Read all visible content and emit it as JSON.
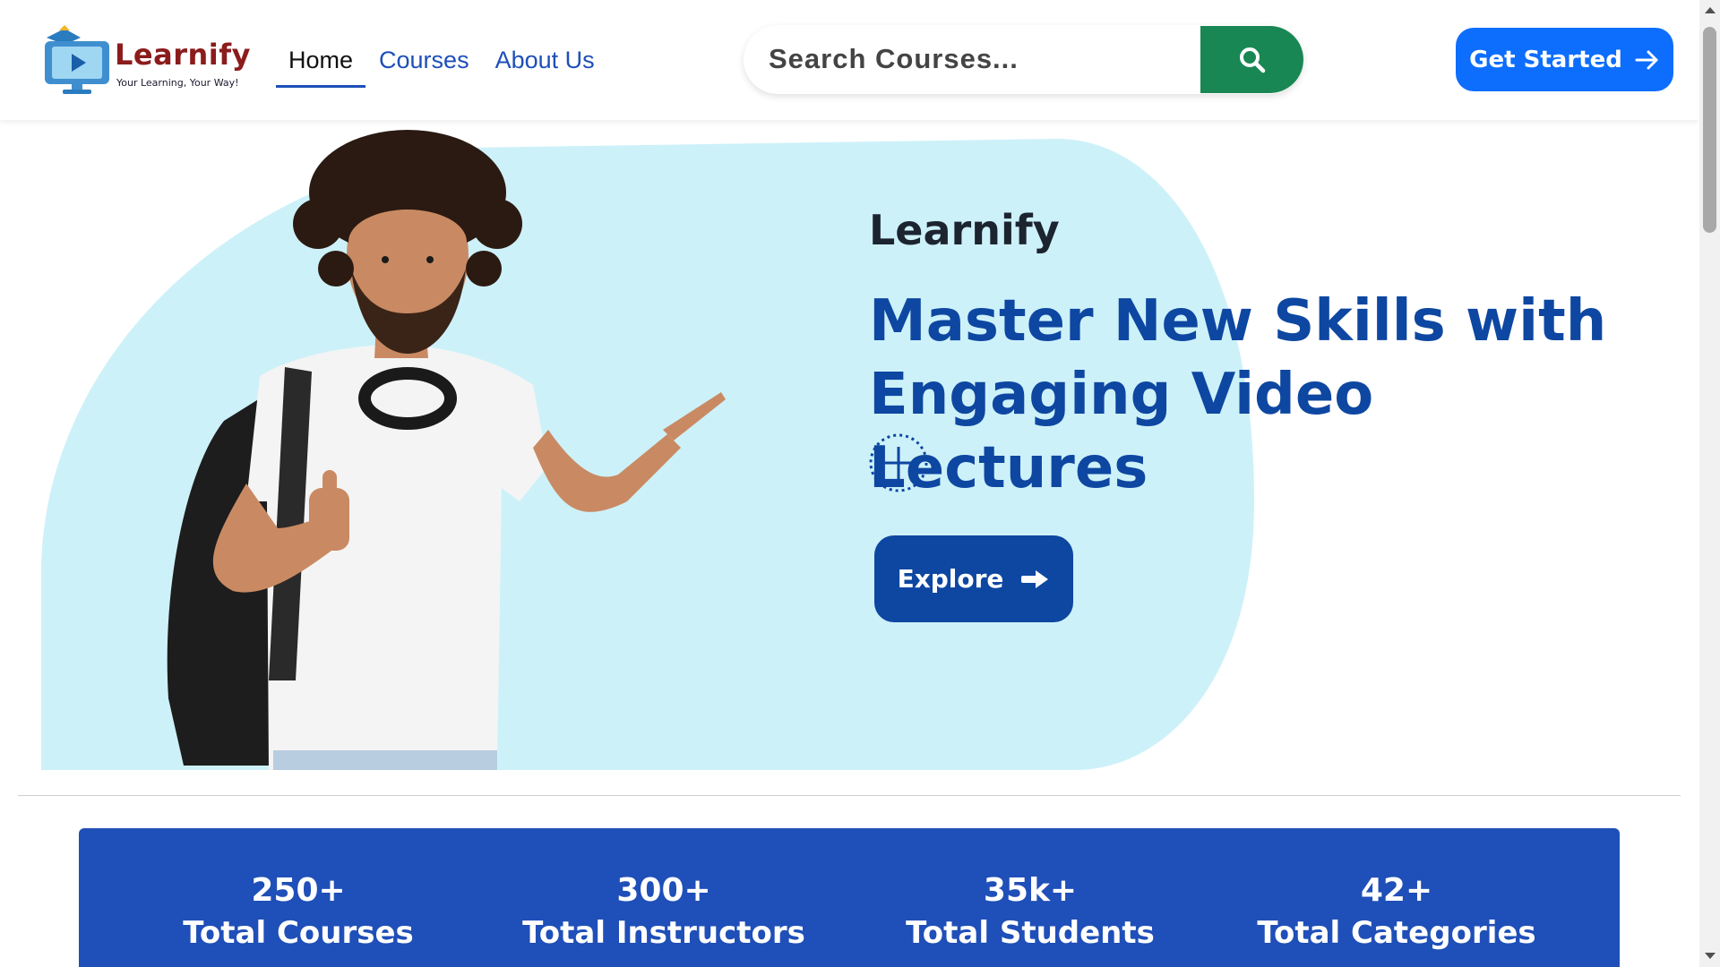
{
  "brand": {
    "name": "Learnify",
    "tagline": "Your Learning, Your Way!"
  },
  "nav": {
    "items": [
      {
        "label": "Home",
        "active": true
      },
      {
        "label": "Courses",
        "active": false
      },
      {
        "label": "About Us",
        "active": false
      }
    ]
  },
  "search": {
    "placeholder": "Search Courses...",
    "value": "",
    "button_icon": "search-icon"
  },
  "header_cta": {
    "label": "Get Started",
    "icon": "arrow-right-icon"
  },
  "hero": {
    "eyebrow": "Learnify",
    "title": "Master New Skills with Engaging Video Lectures",
    "explore_label": "Explore",
    "explore_icon": "arrow-right-icon",
    "decor_icon": "plus-circle-icon"
  },
  "stats": [
    {
      "value": "250+",
      "label": "Total Courses"
    },
    {
      "value": "300+",
      "label": "Total Instructors"
    },
    {
      "value": "35k+",
      "label": "Total Students"
    },
    {
      "value": "42+",
      "label": "Total Categories"
    }
  ],
  "colors": {
    "primary": "#0d6efd",
    "dark_blue": "#0d47a1",
    "stats_blue": "#1f4fb8",
    "search_green": "#198754",
    "hero_bg": "#cdf1f9",
    "brand_red": "#8b1c1c"
  }
}
